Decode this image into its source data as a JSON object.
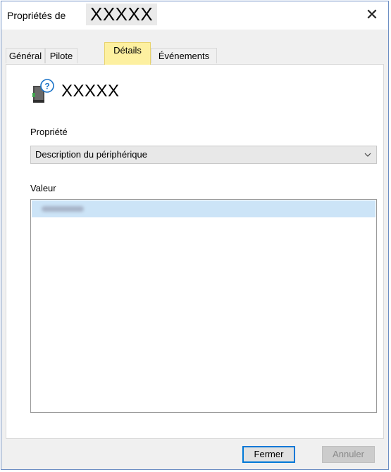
{
  "window": {
    "title_prefix": "Propriétés de",
    "device_name": "XXXXX",
    "close_glyph": "✕"
  },
  "tabs": [
    {
      "label": "Général",
      "active": false
    },
    {
      "label": "Pilote",
      "active": false
    },
    {
      "label": "Détails",
      "active": true
    },
    {
      "label": "Événements",
      "active": false
    }
  ],
  "details": {
    "device_title": "XXXXX",
    "icon": "unknown-device-icon",
    "property_label": "Propriété",
    "property_selected": "Description du périphérique",
    "value_label": "Valeur",
    "values": [
      ""
    ]
  },
  "buttons": {
    "close_label": "Fermer",
    "cancel_label": "Annuler"
  },
  "colors": {
    "tab_highlight": "#fdf0a0",
    "selection": "#cce4f7",
    "focus_border": "#0078d7"
  }
}
